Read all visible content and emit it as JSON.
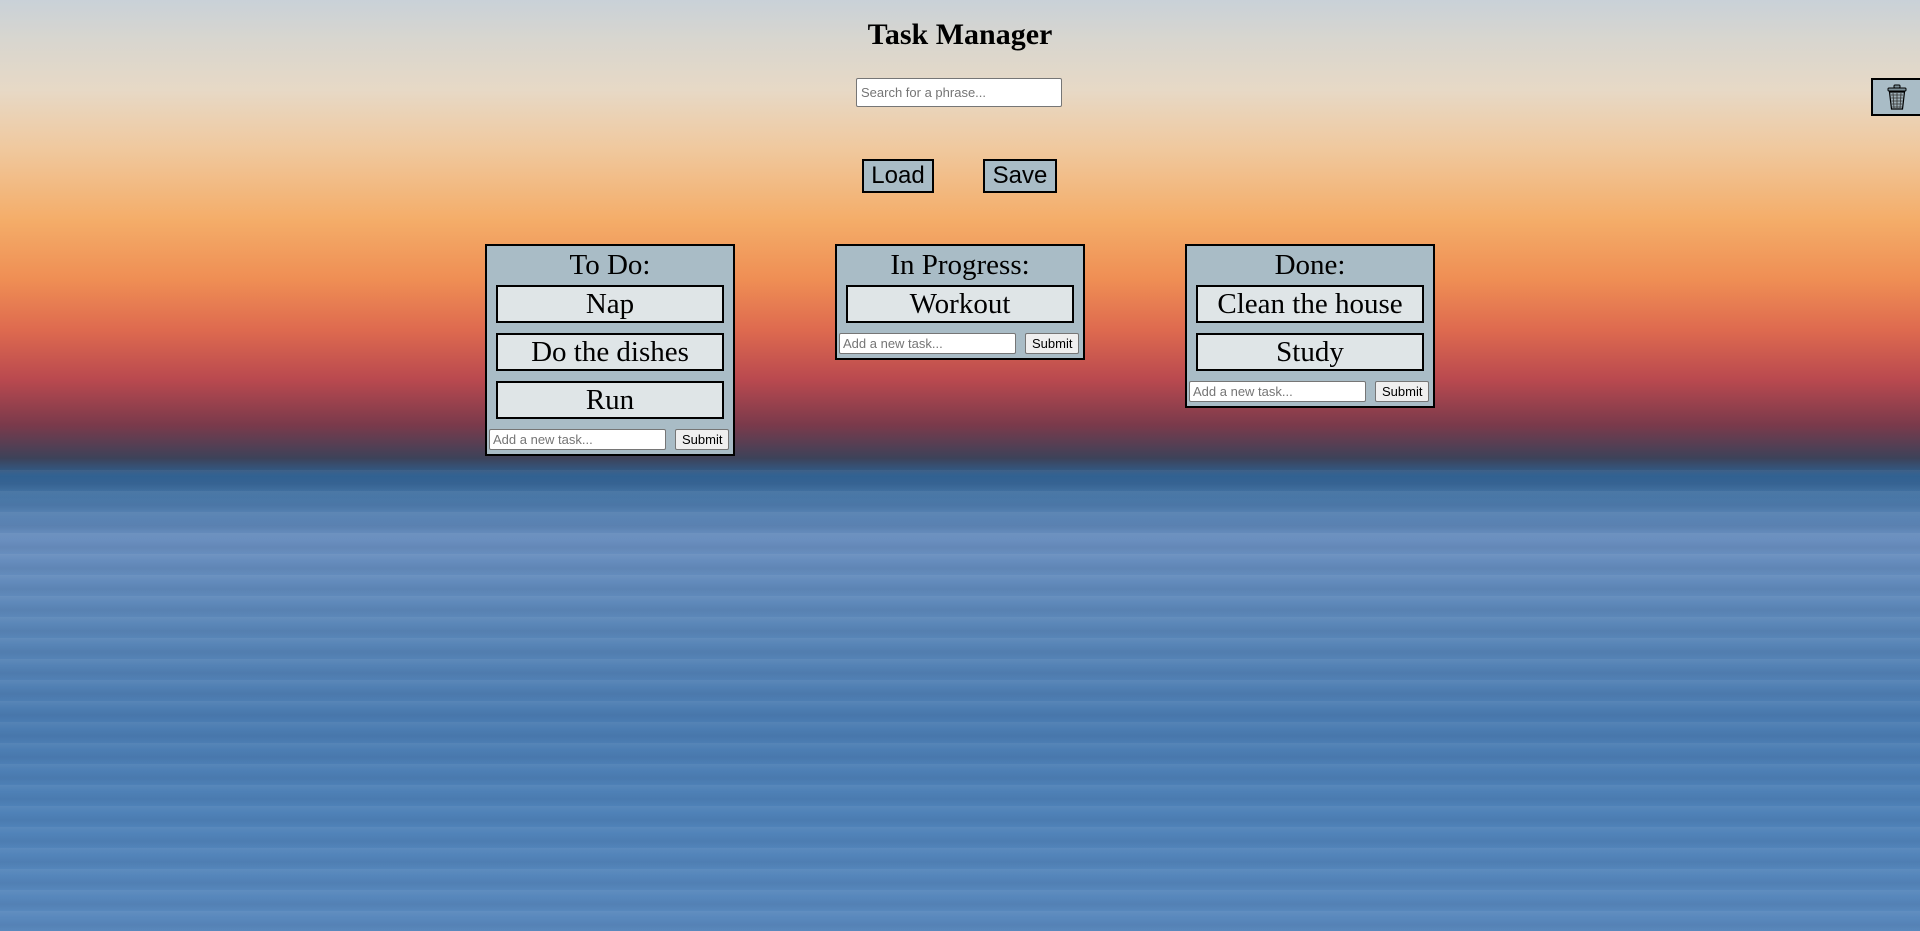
{
  "app": {
    "title": "Task Manager"
  },
  "search": {
    "placeholder": "Search for a phrase...",
    "value": ""
  },
  "toolbar": {
    "load_label": "Load",
    "save_label": "Save",
    "trash_icon": "trash-can-icon"
  },
  "columns": [
    {
      "title": "To Do:",
      "tasks": [
        "Nap",
        "Do the dishes",
        "Run"
      ],
      "input_placeholder": "Add a new task...",
      "submit_label": "Submit"
    },
    {
      "title": "In Progress:",
      "tasks": [
        "Workout"
      ],
      "input_placeholder": "Add a new task...",
      "submit_label": "Submit"
    },
    {
      "title": "Done:",
      "tasks": [
        "Clean the house",
        "Study"
      ],
      "input_placeholder": "Add a new task...",
      "submit_label": "Submit"
    }
  ],
  "colors": {
    "panel": "#a9bcc6",
    "task_card": "#dfe5e7",
    "border": "#000000"
  }
}
